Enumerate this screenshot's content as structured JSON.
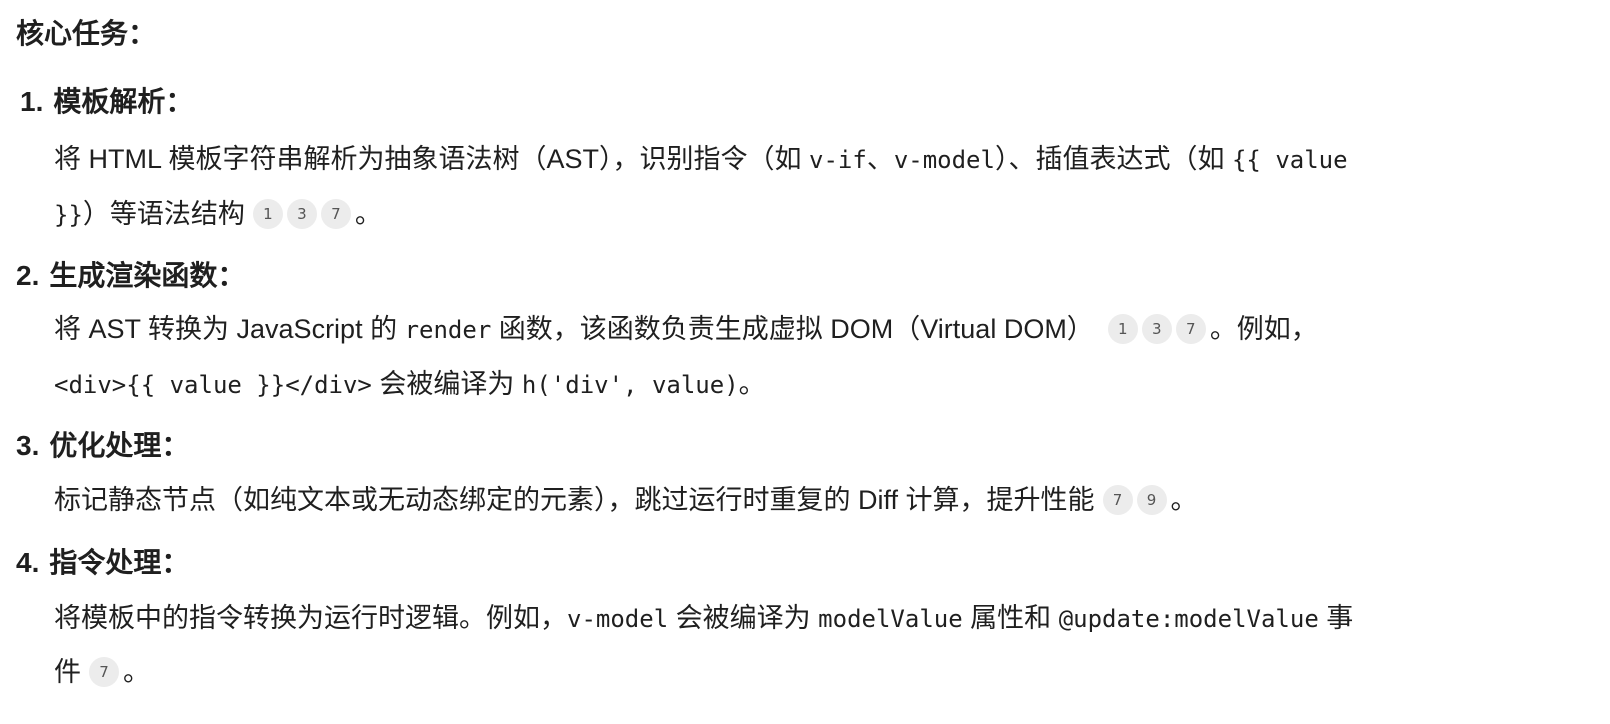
{
  "heading": "核心任务：",
  "items": [
    {
      "num": "1.",
      "title": "模板解析：",
      "line1": {
        "t1": "将 HTML 模板字符串解析为抽象语法树（AST），识别指令（如 ",
        "c1": "v-if",
        "t2": "、",
        "c2": "v-model",
        "t3": "）、插值表达式（如 ",
        "c3": "{{ value"
      },
      "line2": {
        "c1": "}}",
        "t1": "）等语法结构",
        "cites": [
          "1",
          "3",
          "7"
        ],
        "t2": "。"
      }
    },
    {
      "num": "2.",
      "title": "生成渲染函数：",
      "line1": {
        "t1": "将 AST 转换为 JavaScript 的 ",
        "c1": "render",
        "t2": " 函数，该函数负责生成虚拟 DOM（Virtual DOM）",
        "cites": [
          "1",
          "3",
          "7"
        ],
        "t3": "。例如，"
      },
      "line2": {
        "c1": "<div>{{ value }}</div>",
        "t1": " 会被编译为 ",
        "c2": "h('div', value)",
        "t2": "。"
      }
    },
    {
      "num": "3.",
      "title": "优化处理：",
      "line1": {
        "t1": "标记静态节点（如纯文本或无动态绑定的元素），跳过运行时重复的 Diff 计算，提升性能",
        "cites": [
          "7",
          "9"
        ],
        "t2": "。"
      }
    },
    {
      "num": "4.",
      "title": "指令处理：",
      "line1": {
        "t1": "将模板中的指令转换为运行时逻辑。例如，",
        "c1": "v-model",
        "t2": " 会被编译为 ",
        "c2": "modelValue",
        "t3": " 属性和 ",
        "c3": "@update:modelValue",
        "t4": " 事"
      },
      "line2": {
        "t1": "件",
        "cites": [
          "7"
        ],
        "t2": "。"
      }
    }
  ]
}
